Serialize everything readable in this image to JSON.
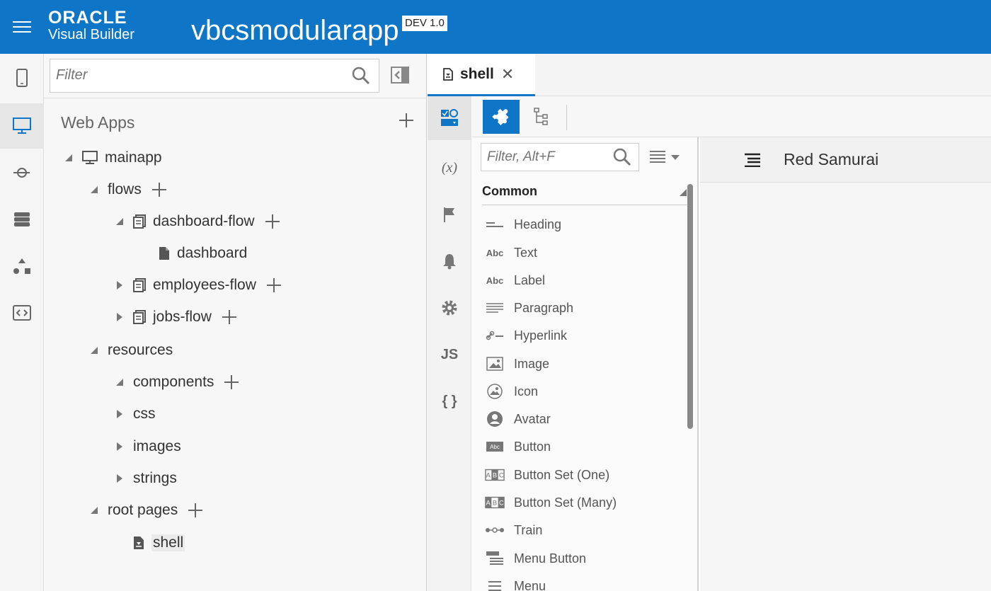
{
  "header": {
    "brand_line1": "ORACLE",
    "brand_line2": "Visual Builder",
    "app_name": "vbcsmodularapp",
    "version": "DEV 1.0",
    "bg_color": "#0f76c7"
  },
  "left_rail": {
    "items": [
      {
        "icon": "mobile-icon"
      },
      {
        "icon": "monitor-icon",
        "active": true
      },
      {
        "icon": "service-connection-icon"
      },
      {
        "icon": "database-icon"
      },
      {
        "icon": "process-icon"
      },
      {
        "icon": "source-code-icon"
      }
    ]
  },
  "navigator": {
    "filter_placeholder": "Filter",
    "section_title": "Web Apps",
    "tree": [
      {
        "label": "mainapp",
        "icon": "monitor-icon",
        "state": "expanded",
        "add": false
      },
      {
        "label": "flows",
        "icon": "",
        "state": "expanded",
        "add": true
      },
      {
        "label": "dashboard-flow",
        "icon": "flow-icon",
        "state": "expanded",
        "add": true
      },
      {
        "label": "dashboard",
        "icon": "page-icon",
        "state": "leaf",
        "add": false
      },
      {
        "label": "employees-flow",
        "icon": "flow-icon",
        "state": "collapsed",
        "add": true
      },
      {
        "label": "jobs-flow",
        "icon": "flow-icon",
        "state": "collapsed",
        "add": true
      },
      {
        "label": "resources",
        "icon": "",
        "state": "expanded",
        "add": false
      },
      {
        "label": "components",
        "icon": "",
        "state": "expanded",
        "add": true
      },
      {
        "label": "css",
        "icon": "",
        "state": "collapsed",
        "add": false
      },
      {
        "label": "images",
        "icon": "",
        "state": "collapsed",
        "add": false
      },
      {
        "label": "strings",
        "icon": "",
        "state": "collapsed",
        "add": false
      },
      {
        "label": "root pages",
        "icon": "",
        "state": "expanded",
        "add": true
      },
      {
        "label": "shell",
        "icon": "shell-page-icon",
        "state": "leaf",
        "add": false
      }
    ]
  },
  "editor": {
    "tab_label": "shell",
    "tab_close": "✕"
  },
  "side_rail2": {
    "items": [
      {
        "icon": "components-icon",
        "active": true,
        "text": ""
      },
      {
        "icon": "variables-icon",
        "text": "(x)"
      },
      {
        "icon": "flag-icon",
        "text": ""
      },
      {
        "icon": "bell-icon",
        "text": ""
      },
      {
        "icon": "gear-icon",
        "text": ""
      },
      {
        "icon": "js-icon",
        "text": "JS"
      },
      {
        "icon": "json-icon",
        "text": "{ }"
      }
    ]
  },
  "palette": {
    "filter_placeholder": "Filter, Alt+F",
    "section": "Common",
    "items": [
      {
        "label": "Heading",
        "icon": "heading-icon"
      },
      {
        "label": "Text",
        "icon": "text-icon"
      },
      {
        "label": "Label",
        "icon": "label-icon"
      },
      {
        "label": "Paragraph",
        "icon": "paragraph-icon"
      },
      {
        "label": "Hyperlink",
        "icon": "hyperlink-icon"
      },
      {
        "label": "Image",
        "icon": "image-icon"
      },
      {
        "label": "Icon",
        "icon": "icon-icon"
      },
      {
        "label": "Avatar",
        "icon": "avatar-icon"
      },
      {
        "label": "Button",
        "icon": "button-icon"
      },
      {
        "label": "Button Set (One)",
        "icon": "button-set-one-icon"
      },
      {
        "label": "Button Set (Many)",
        "icon": "button-set-many-icon"
      },
      {
        "label": "Train",
        "icon": "train-icon"
      },
      {
        "label": "Menu Button",
        "icon": "menu-button-icon"
      },
      {
        "label": "Menu",
        "icon": "menu-icon"
      }
    ]
  },
  "canvas": {
    "title": "Red Samurai"
  }
}
